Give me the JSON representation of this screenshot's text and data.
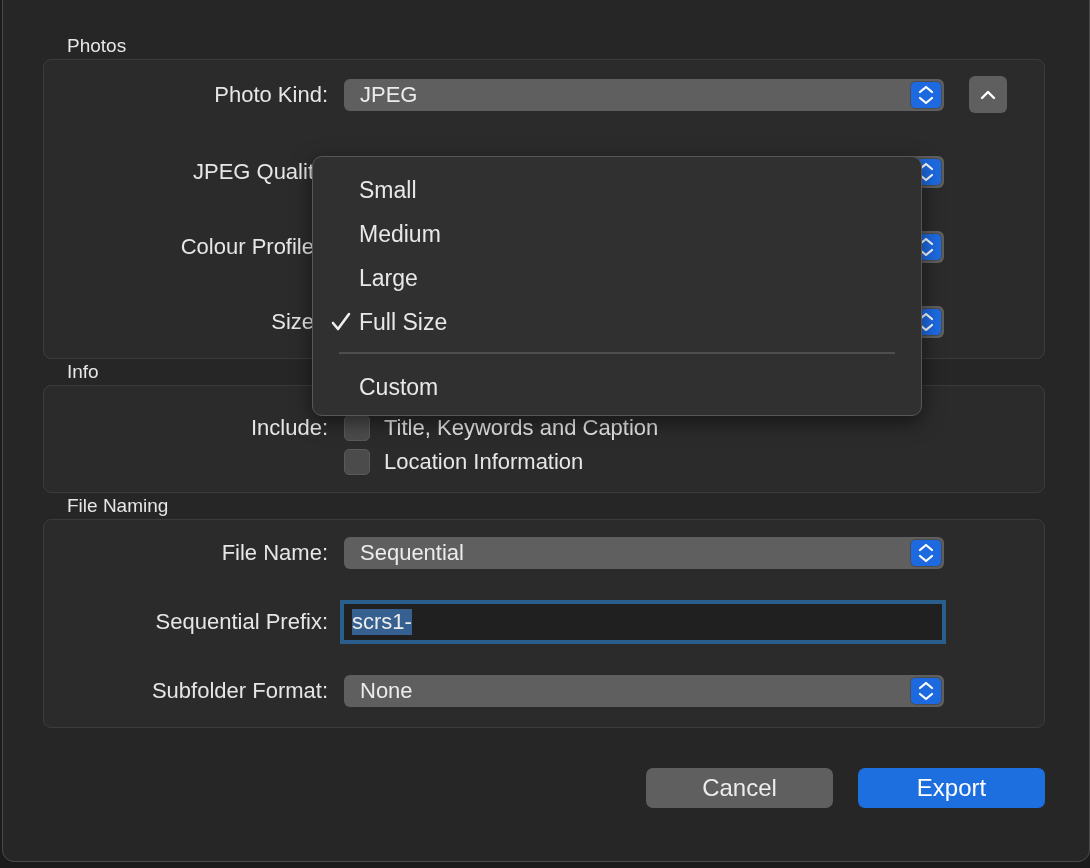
{
  "sections": [
    {
      "title": "Photos",
      "rows": [
        {
          "kind": "select",
          "label": "Photo Kind:",
          "value": "JPEG"
        },
        {
          "kind": "select",
          "label": "JPEG Qualit"
        },
        {
          "kind": "select",
          "label": "Colour Profile"
        },
        {
          "kind": "select",
          "label": "Size"
        }
      ]
    },
    {
      "title": "Info",
      "rows": [
        {
          "kind": "checkbox",
          "label": "Include:",
          "text": "Title, Keywords and Caption",
          "checked": false
        },
        {
          "kind": "checkbox",
          "text": "Location Information",
          "checked": false
        }
      ]
    },
    {
      "title": "File Naming",
      "rows": [
        {
          "kind": "select",
          "label": "File Name:",
          "value": "Sequential"
        },
        {
          "kind": "field",
          "label": "Sequential Prefix:",
          "value": "scrs1-",
          "focused": true
        },
        {
          "kind": "select",
          "label": "Subfolder Format:",
          "value": "None"
        }
      ]
    }
  ],
  "menu": {
    "items": [
      {
        "kind": "item",
        "label": "Small",
        "selected": false
      },
      {
        "kind": "item",
        "label": "Medium",
        "selected": false
      },
      {
        "kind": "item",
        "label": "Large",
        "selected": false
      },
      {
        "kind": "item",
        "label": "Full Size",
        "selected": true
      },
      {
        "kind": "separator"
      },
      {
        "kind": "item",
        "label": "Custom",
        "selected": false
      }
    ]
  },
  "buttons": [
    {
      "kind": "default",
      "label": "Cancel"
    },
    {
      "kind": "primary",
      "label": "Export"
    }
  ]
}
